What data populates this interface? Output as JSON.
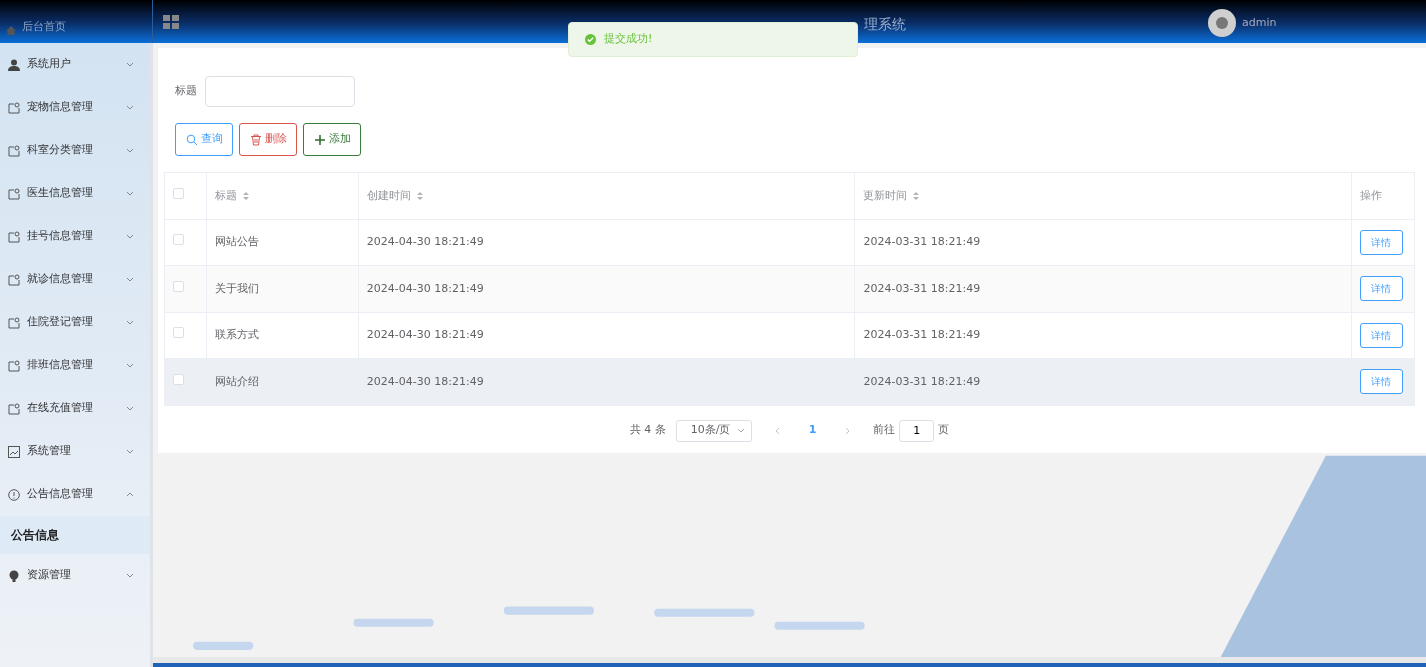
{
  "header": {
    "home_link": "后台首页",
    "title": "理系统",
    "user": "admin"
  },
  "toast": {
    "message": "提交成功!"
  },
  "sidebar": {
    "items": [
      {
        "label": "系统用户",
        "expanded": false
      },
      {
        "label": "宠物信息管理",
        "expanded": false
      },
      {
        "label": "科室分类管理",
        "expanded": false
      },
      {
        "label": "医生信息管理",
        "expanded": false
      },
      {
        "label": "挂号信息管理",
        "expanded": false
      },
      {
        "label": "就诊信息管理",
        "expanded": false
      },
      {
        "label": "住院登记管理",
        "expanded": false
      },
      {
        "label": "排班信息管理",
        "expanded": false
      },
      {
        "label": "在线充值管理",
        "expanded": false
      },
      {
        "label": "系统管理",
        "expanded": false
      },
      {
        "label": "公告信息管理",
        "expanded": true,
        "children": [
          {
            "label": "公告信息",
            "selected": true
          }
        ]
      },
      {
        "label": "资源管理",
        "expanded": false
      }
    ]
  },
  "search": {
    "label": "标题"
  },
  "buttons": [
    {
      "label": "查询",
      "kind": "search"
    },
    {
      "label": "删除",
      "kind": "delete"
    },
    {
      "label": "添加",
      "kind": "add"
    }
  ],
  "table": {
    "select_all_checked": false,
    "columns": [
      "标题",
      "创建时间",
      "更新时间",
      "操作"
    ],
    "rows": [
      {
        "title": "网站公告",
        "created": "2024-04-30 18:21:49",
        "updated": "2024-03-31 18:21:49",
        "action": "详情",
        "checked": false,
        "hovered": false
      },
      {
        "title": "关于我们",
        "created": "2024-04-30 18:21:49",
        "updated": "2024-03-31 18:21:49",
        "action": "详情",
        "checked": false,
        "hovered": false
      },
      {
        "title": "联系方式",
        "created": "2024-04-30 18:21:49",
        "updated": "2024-03-31 18:21:49",
        "action": "详情",
        "checked": false,
        "hovered": false
      },
      {
        "title": "网站介绍",
        "created": "2024-04-30 18:21:49",
        "updated": "2024-03-31 18:21:49",
        "action": "详情",
        "checked": false,
        "hovered": true
      }
    ]
  },
  "pagination": {
    "total": "共 4 条",
    "page_size": "10条/页",
    "pages": [
      {
        "label": "1",
        "selected": true
      }
    ],
    "goto_label": "前往",
    "goto_value": "1",
    "goto_suffix": "页"
  }
}
